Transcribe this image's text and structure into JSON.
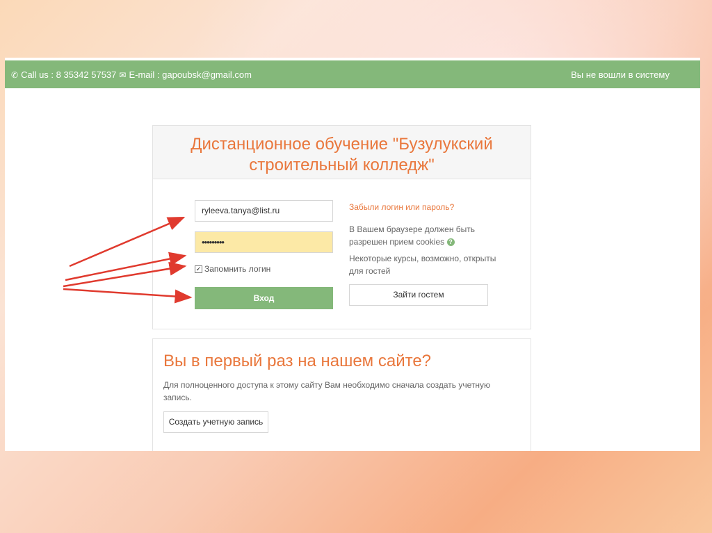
{
  "topbar": {
    "call_text": "Call us : 8 35342 57537",
    "email_text": "E-mail : gapoubsk@gmail.com",
    "login_status": "Вы не вошли в систему"
  },
  "login": {
    "title": "Дистанционное обучение \"Бузулукский строительный колледж\"",
    "username_value": "ryleeva.tanya@list.ru",
    "password_value": "•••••••••",
    "remember_label": "Запомнить логин",
    "remember_checked": "✓",
    "submit_label": "Вход",
    "forgot_link": "Забыли логин или пароль?",
    "cookies_text": "В Вашем браузере должен быть разрешен прием cookies",
    "help_icon": "?",
    "guest_text": "Некоторые курсы, возможно, открыты для гостей",
    "guest_button": "Зайти гостем"
  },
  "signup": {
    "title": "Вы в первый раз на нашем сайте?",
    "text": "Для полноценного доступа к этому сайту Вам необходимо сначала создать учетную запись.",
    "button": "Создать учетную запись"
  },
  "annotation": {
    "arrow_color": "#e03a2e"
  },
  "colors": {
    "accent_green": "#84b87a",
    "title_orange": "#e9773c",
    "autofill_yellow": "#fce9a6"
  },
  "icons": {
    "phone": "phone-icon",
    "envelope": "envelope-icon",
    "help": "help-icon"
  }
}
